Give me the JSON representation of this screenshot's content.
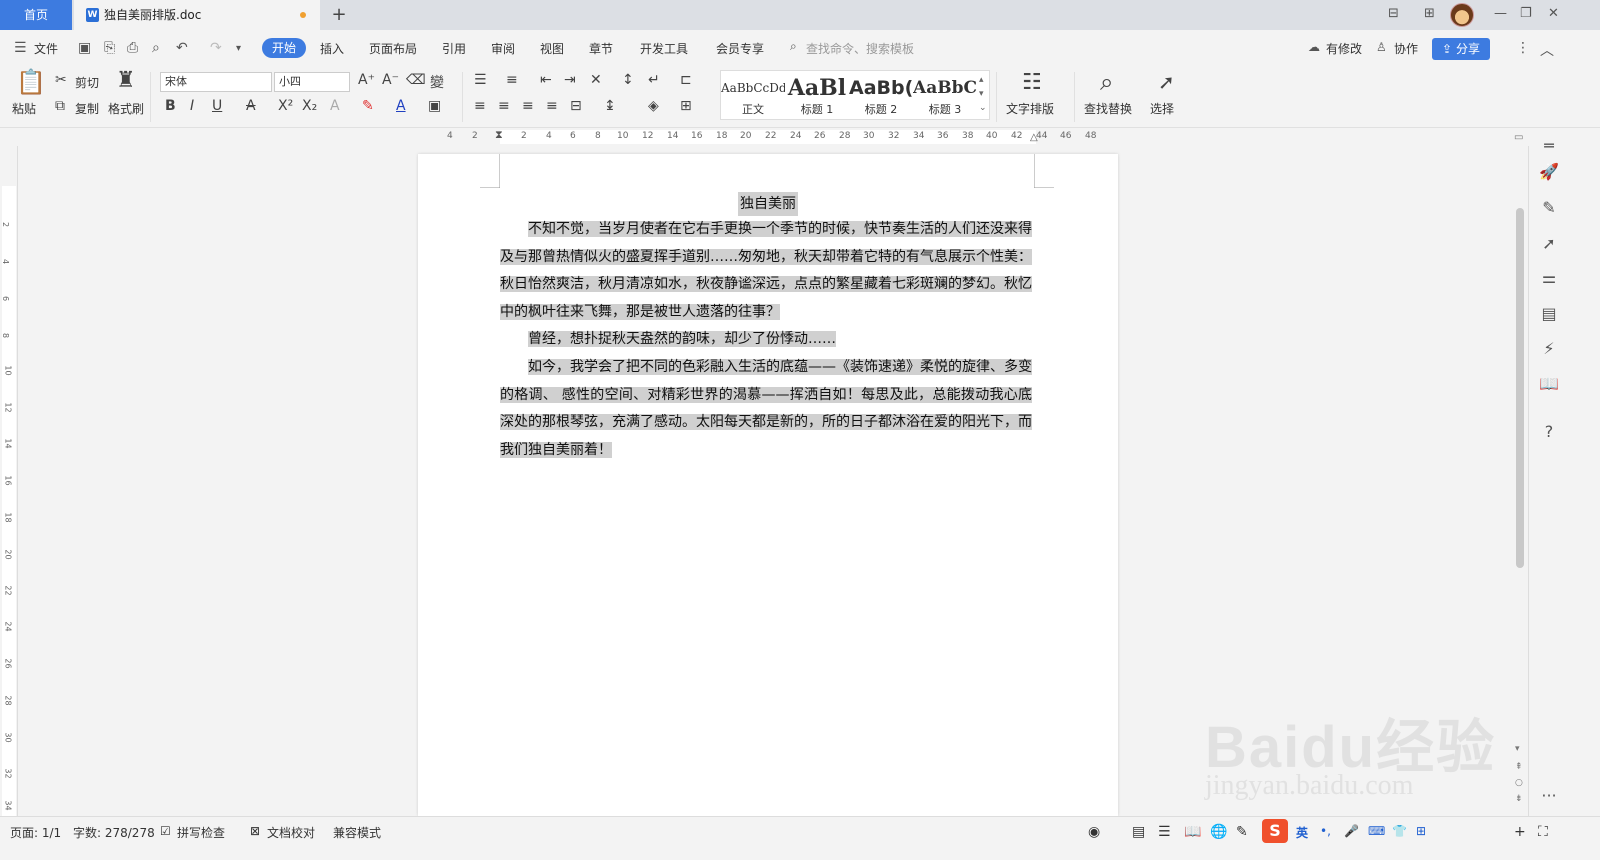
{
  "tabbar": {
    "home_tab": "首页",
    "doc_tab": "独自美丽排版.doc",
    "doc_icon": "W",
    "add_tab": "+",
    "window_controls": [
      "—",
      "❐",
      "✕"
    ]
  },
  "menubar": {
    "file": "文件",
    "active": "开始",
    "items": [
      "插入",
      "页面布局",
      "引用",
      "审阅",
      "视图",
      "章节",
      "开发工具",
      "会员专享"
    ],
    "search_placeholder": "查找命令、搜索模板",
    "modified": "有修改",
    "collab": "协作",
    "share": "分享"
  },
  "ribbon": {
    "paste": "粘贴",
    "cut": "剪切",
    "copy": "复制",
    "format_painter": "格式刷",
    "font": "宋体",
    "size": "小四",
    "styles": [
      {
        "preview": "AaBbCcDd",
        "label": "正文"
      },
      {
        "preview": "AaBl",
        "label": "标题 1"
      },
      {
        "preview": "AaBb(",
        "label": "标题 2"
      },
      {
        "preview": "AaBbC",
        "label": "标题 3"
      }
    ],
    "text_layout": "文字排版",
    "find_replace": "查找替换",
    "select": "选择"
  },
  "ruler": {
    "h_numbers": [
      "4",
      "2",
      "2",
      "4",
      "6",
      "8",
      "10",
      "12",
      "14",
      "16",
      "18",
      "20",
      "22",
      "24",
      "26",
      "28",
      "30",
      "32",
      "34",
      "36",
      "38",
      "40",
      "42",
      "44",
      "46",
      "48"
    ],
    "v_numbers": [
      "2",
      "4",
      "6",
      "8",
      "10",
      "12",
      "14",
      "16",
      "18",
      "20",
      "22",
      "24",
      "26",
      "28",
      "30",
      "32",
      "34"
    ]
  },
  "document": {
    "title": "独自美丽",
    "paragraphs": [
      "不知不觉，当岁月使者在它右手更换一个季节的时候，快节奏生活的人们还没来得及与那曾热情似火的盛夏挥手道别……匆匆地，秋天却带着它特的有气息展示个性美：秋日怡然爽洁，秋月清凉如水，秋夜静谧深远，点点的繁星藏着七彩斑斓的梦幻。秋忆中的枫叶往来飞舞，那是被世人遗落的往事？",
      "曾经，想扑捉秋天盎然的韵味，却少了份悸动……",
      "如今，我学会了把不同的色彩融入生活的底蕴——《装饰速递》柔悦的旋律、多变的格调、  感性的空间、对精彩世界的渴慕——挥洒自如！每思及此，总能拨动我心底深处的那根琴弦，充满了感动。太阳每天都是新的，所的日子都沐浴在爱的阳光下，而我们独自美丽着！"
    ]
  },
  "status": {
    "page": "页面: 1/1",
    "words": "字数: 278/278",
    "spell": "拼写检查",
    "proof": "文档校对",
    "compat": "兼容模式",
    "ime": "英"
  },
  "watermark": {
    "main": "Baidu经验",
    "sub": "jingyan.baidu.com"
  }
}
